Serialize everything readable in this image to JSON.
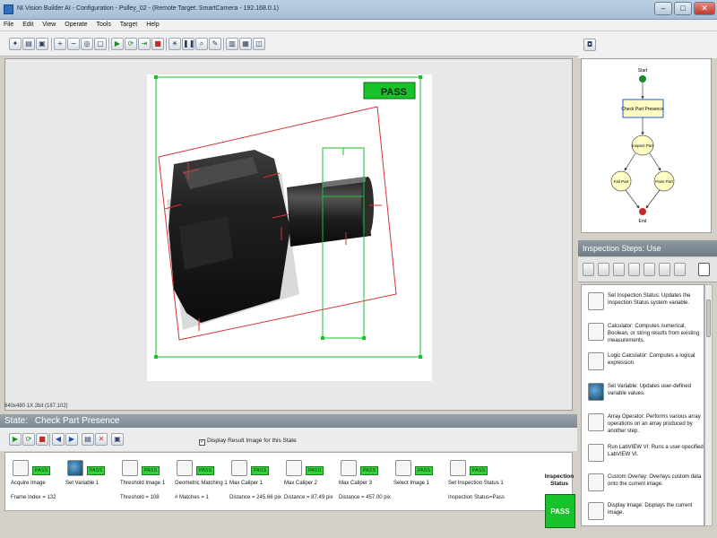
{
  "window": {
    "title": "NI Vision Builder AI - Configuration - Pulley_02 - (Remote Target: SmartCamera - 192.168.0.1)",
    "minimize": "–",
    "maximize": "□",
    "close": "✕"
  },
  "menu": [
    "File",
    "Edit",
    "View",
    "Operate",
    "Tools",
    "Target",
    "Help"
  ],
  "image": {
    "pass_label": "PASS",
    "info": "640x480 1X 2bit",
    "coords": "(187,102)"
  },
  "state_bar": {
    "prefix": "State:",
    "name": "Check Part Presence"
  },
  "display_result_label": "Display Result Image for this State",
  "steps": [
    {
      "name": "Acquire Image",
      "value": "Frame Index = 132",
      "status": "PASS"
    },
    {
      "name": "Set Variable 1",
      "value": "",
      "status": "PASS"
    },
    {
      "name": "Threshold Image 1",
      "value": "Threshold = 108",
      "status": "PASS"
    },
    {
      "name": "Geometric Matching 1",
      "value": "# Matches = 1",
      "status": "PASS"
    },
    {
      "name": "Max Caliper 1",
      "value": "Distance = 245.66 pix",
      "status": "PASS"
    },
    {
      "name": "Max Caliper 2",
      "value": "Distance = 87.49 pix",
      "status": "PASS"
    },
    {
      "name": "Max Caliper 3",
      "value": "Distance = 457.00 pix",
      "status": "PASS"
    },
    {
      "name": "Select Image 1",
      "value": "",
      "status": "PASS"
    },
    {
      "name": "Set Inspection Status 1",
      "value": "Inspection Status=Pass",
      "status": "PASS"
    }
  ],
  "inspection_status": {
    "label_line1": "Inspection",
    "label_line2": "Status",
    "value": "PASS"
  },
  "flow": {
    "start": "Start",
    "check": "Check Part Presence",
    "inspect": "Inspect Part",
    "fail": "Fail Part",
    "pass": "Pass Part",
    "end": "End"
  },
  "steps_panel": {
    "title": "Inspection Steps: Use"
  },
  "palette": [
    {
      "text": "Set Inspection Status: Updates the Inspection Status system variable."
    },
    {
      "text": "Calculator: Computes numerical, Boolean, or string results from existing measurements."
    },
    {
      "text": "Logic Calculator: Computes a logical expression."
    },
    {
      "text": "Set Variable: Updates user-defined variable values."
    },
    {
      "text": "Array Operator: Performs various array operations on an array produced by another step."
    },
    {
      "text": "Run LabVIEW VI: Runs a user-specified LabVIEW VI."
    },
    {
      "text": "Custom Overlay: Overlays custom data onto the current image."
    },
    {
      "text": "Display Image: Displays the current image."
    }
  ],
  "colors": {
    "pass_green": "#18c229",
    "overlay_green": "#19c22a",
    "overlay_red": "#d23434",
    "state_bar": "#8a939d"
  }
}
